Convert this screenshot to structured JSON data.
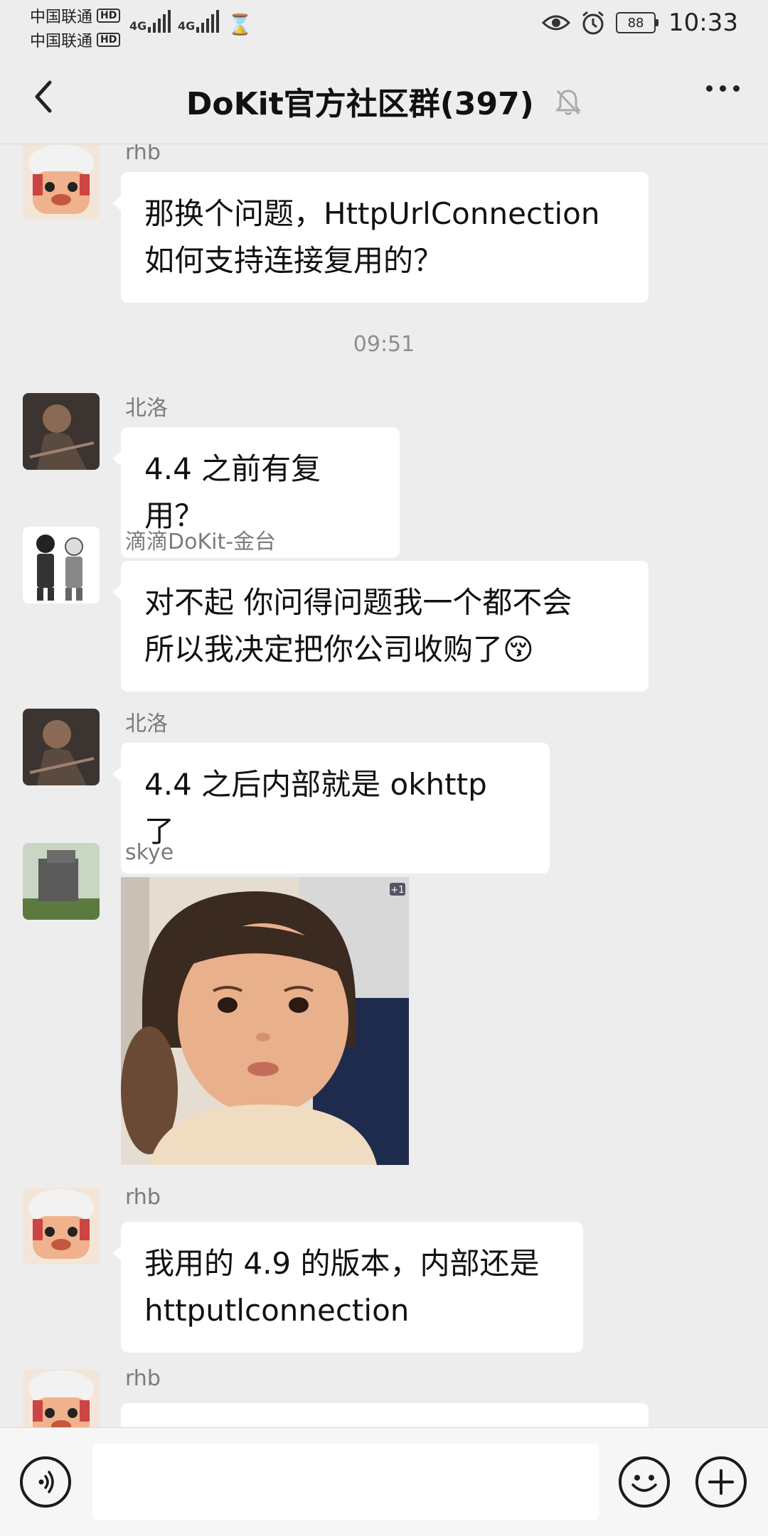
{
  "status_bar": {
    "carrier1": "中国联通",
    "carrier2": "中国联通",
    "hd_badge": "HD",
    "network1": "4G",
    "network2": "4G",
    "battery": "88",
    "time": "10:33"
  },
  "header": {
    "title": "DoKit官方社区群(397)"
  },
  "messages": [
    {
      "sender": "rhb",
      "text_lines": [
        "那换个问题，HttpUrlConnection",
        "如何支持连接复用的？"
      ]
    },
    {
      "timestamp": "09:51"
    },
    {
      "sender": "北洛",
      "text_lines": [
        "4.4 之前有复用？"
      ]
    },
    {
      "sender": "滴滴DoKit-金台",
      "text_lines": [
        "对不起 你问得问题我一个都不会",
        "所以我决定把你公司收购了😚"
      ]
    },
    {
      "sender": "北洛",
      "text_lines": [
        "4.4 之后内部就是 okhttp 了"
      ]
    },
    {
      "sender": "skye",
      "sticker_badge": "+1"
    },
    {
      "sender": "rhb",
      "text_lines": [
        "我用的 4.9 的版本，内部还是",
        "httputlconnection"
      ]
    },
    {
      "sender": "rhb"
    }
  ],
  "input_bar": {
    "text": ""
  },
  "colors": {
    "background": "#ededed",
    "bubble": "#ffffff",
    "sender_text": "#7b7b7b"
  }
}
